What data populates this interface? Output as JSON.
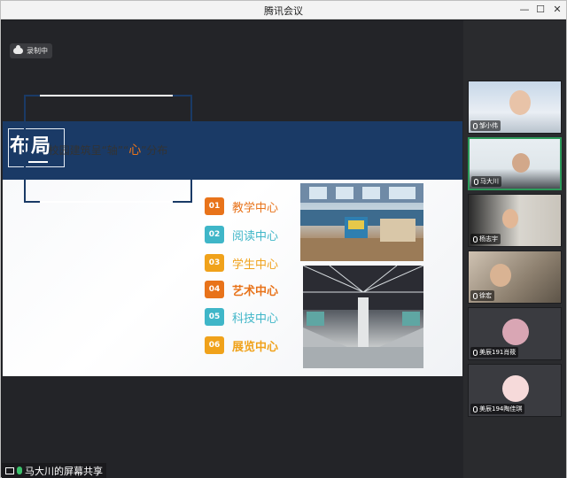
{
  "window": {
    "title": "腾讯会议"
  },
  "recording": {
    "label": "录制中"
  },
  "slide": {
    "heading": "布局",
    "frame_prefix": "校园建筑呈“轴”“",
    "frame_heart": "心",
    "frame_suffix": "”分布",
    "items": [
      {
        "num": "01",
        "label": "教学中心",
        "num_color": "#e8731a",
        "label_color": "#e8731a",
        "bold": false
      },
      {
        "num": "02",
        "label": "阅读中心",
        "num_color": "#3fb6c8",
        "label_color": "#3fb6c8",
        "bold": false
      },
      {
        "num": "03",
        "label": "学生中心",
        "num_color": "#f0a21b",
        "label_color": "#f0a21b",
        "bold": false
      },
      {
        "num": "04",
        "label": "艺术中心",
        "num_color": "#e8731a",
        "label_color": "#e8731a",
        "bold": true
      },
      {
        "num": "05",
        "label": "科技中心",
        "num_color": "#3fb6c8",
        "label_color": "#3fb6c8",
        "bold": false
      },
      {
        "num": "06",
        "label": "展览中心",
        "num_color": "#f0a21b",
        "label_color": "#f0a21b",
        "bold": true
      }
    ]
  },
  "participants": [
    {
      "name": "邹小伟",
      "active": false
    },
    {
      "name": "马大川",
      "active": true
    },
    {
      "name": "杨志宇",
      "active": false
    },
    {
      "name": "徐宏",
      "active": false
    },
    {
      "name": "美辰191肖筱",
      "active": false
    },
    {
      "name": "美辰194陶佳琪",
      "active": false
    }
  ],
  "share": {
    "label": "马大川的屏幕共享"
  },
  "colors": {
    "header_blue": "#1a3a66",
    "active_border": "#2c9a5a"
  }
}
